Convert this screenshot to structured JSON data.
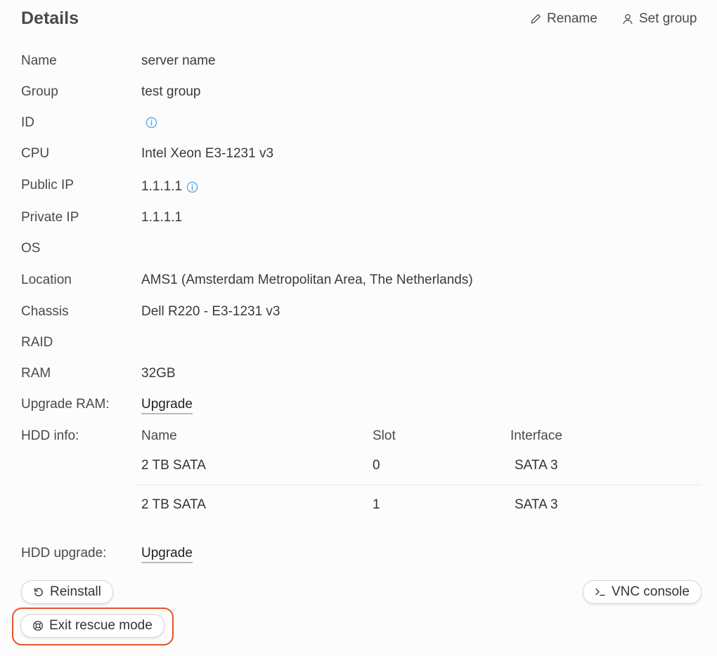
{
  "header": {
    "title": "Details",
    "rename_label": "Rename",
    "set_group_label": "Set group"
  },
  "fields": {
    "name_label": "Name",
    "name_value": "server name",
    "group_label": "Group",
    "group_value": "test group",
    "id_label": "ID",
    "cpu_label": "CPU",
    "cpu_value": "Intel Xeon E3-1231 v3",
    "public_ip_label": "Public IP",
    "public_ip_value": "1.1.1.1",
    "private_ip_label": "Private IP",
    "private_ip_value": "1.1.1.1",
    "os_label": "OS",
    "location_label": "Location",
    "location_value": "AMS1 (Amsterdam Metropolitan Area, The Netherlands)",
    "chassis_label": "Chassis",
    "chassis_value": "Dell R220 - E3-1231 v3",
    "raid_label": "RAID",
    "ram_label": "RAM",
    "ram_value": "32GB",
    "upgrade_ram_label": "Upgrade RAM:",
    "upgrade_ram_link": "Upgrade",
    "hdd_info_label": "HDD info:",
    "hdd_upgrade_label": "HDD upgrade:",
    "hdd_upgrade_link": "Upgrade"
  },
  "hdd_table": {
    "headers": [
      "Name",
      "Slot",
      "Interface"
    ],
    "rows": [
      [
        "2 TB SATA",
        "0",
        "SATA 3"
      ],
      [
        "2 TB SATA",
        "1",
        "SATA 3"
      ]
    ]
  },
  "actions": {
    "reinstall_label": "Reinstall",
    "vnc_label": "VNC console",
    "exit_rescue_label": "Exit rescue mode"
  },
  "colors": {
    "info_icon": "#5aa7e6",
    "highlight": "#e5532b"
  }
}
